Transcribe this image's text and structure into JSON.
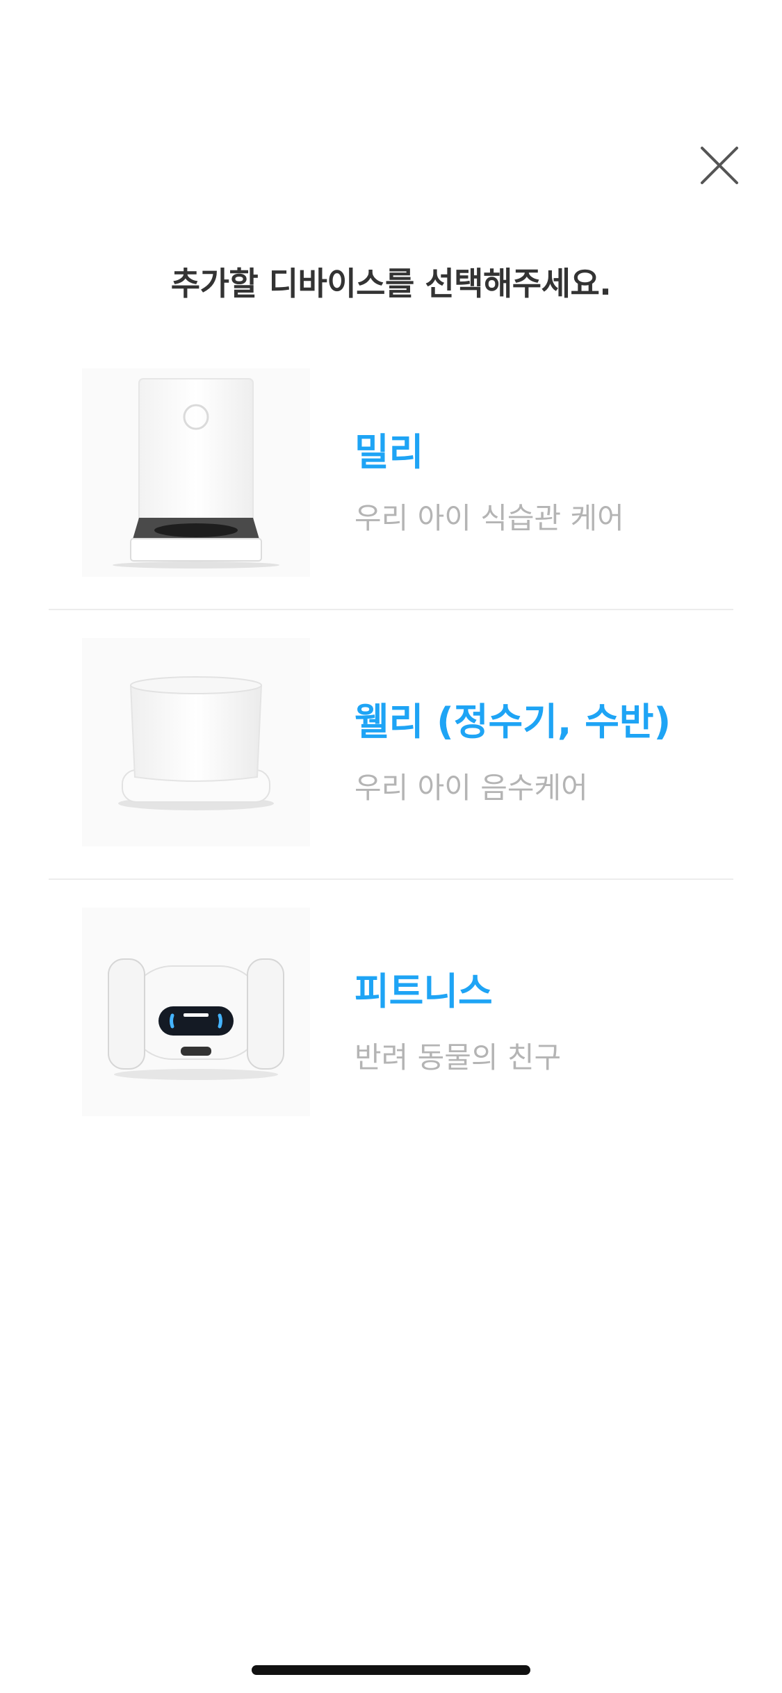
{
  "header": {
    "title": "추가할 디바이스를 선택해주세요.",
    "close_icon": "close-icon"
  },
  "devices": [
    {
      "name": "밀리",
      "description": "우리 아이 식습관 케어",
      "image": "feeder-image"
    },
    {
      "name": "웰리 (정수기, 수반)",
      "description": "우리 아이 음수케어",
      "image": "water-fountain-image"
    },
    {
      "name": "피트니스",
      "description": "반려 동물의 친구",
      "image": "pet-robot-image"
    }
  ],
  "colors": {
    "accent": "#1ea4f5",
    "title": "#333333",
    "subtitle": "#b4b4b4",
    "divider": "#ececec"
  }
}
